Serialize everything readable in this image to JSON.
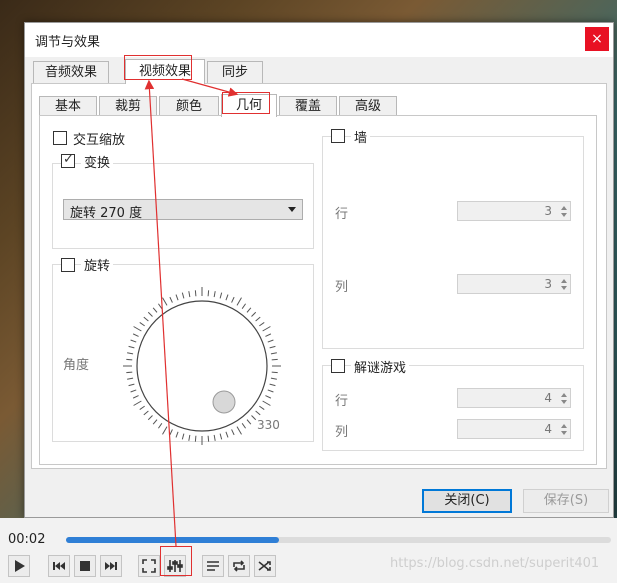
{
  "dialog": {
    "title": "调节与效果",
    "close_glyph": "×",
    "main_tabs": [
      "音频效果",
      "视频效果",
      "同步"
    ],
    "sub_tabs": [
      "基本",
      "裁剪",
      "颜色",
      "几何",
      "覆盖",
      "高级"
    ],
    "geometry": {
      "interactive_zoom": "交互缩放",
      "transform": "变换",
      "transform_checked": true,
      "transform_value": "旋转 270 度",
      "rotate": "旋转",
      "angle_label": "角度",
      "angle_value": "330",
      "wall": "墙",
      "wall_rows_label": "行",
      "wall_rows": "3",
      "wall_cols_label": "列",
      "wall_cols": "3",
      "puzzle": "解谜游戏",
      "puzzle_rows_label": "行",
      "puzzle_rows": "4",
      "puzzle_cols_label": "列",
      "puzzle_cols": "4"
    },
    "buttons": {
      "close": "关闭(C)",
      "save": "保存(S)"
    }
  },
  "player": {
    "time": "00:02",
    "progress": 0.39,
    "accent": "#2f7fd6"
  },
  "watermark": "https://blog.csdn.net/superit401",
  "icons": [
    "play-icon",
    "previous-icon",
    "stop-icon",
    "next-icon",
    "fullscreen-icon",
    "extended-settings-icon",
    "playlist-icon",
    "loop-icon",
    "shuffle-icon"
  ]
}
